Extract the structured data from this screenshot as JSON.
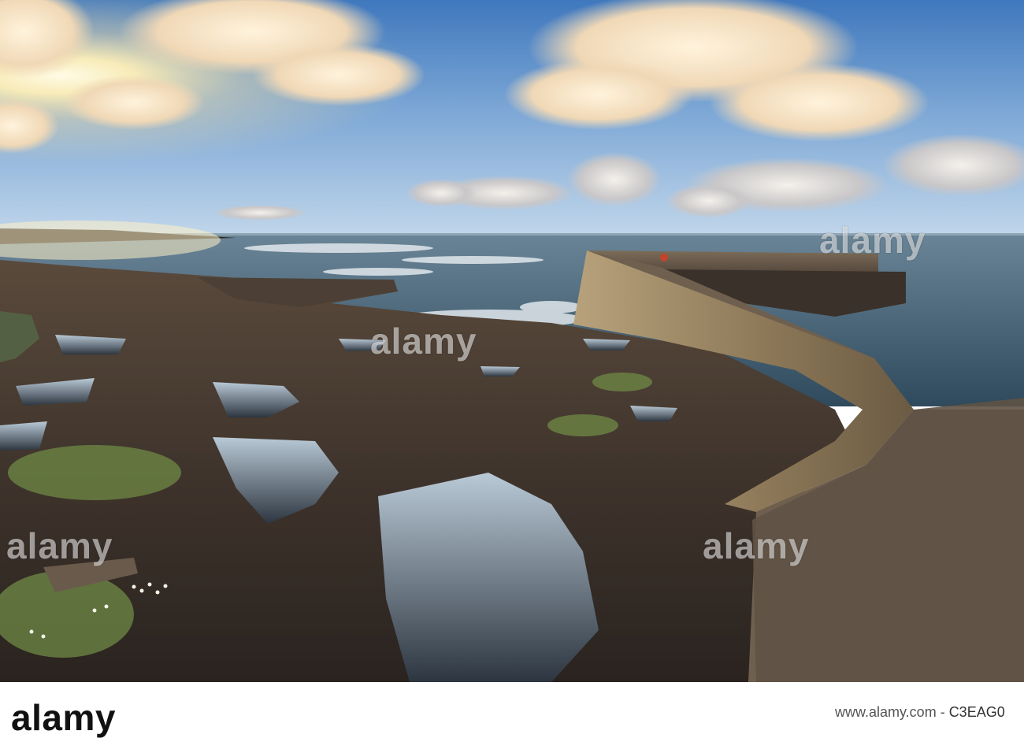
{
  "watermark": {
    "text": "alamy"
  },
  "footer": {
    "logo_text": "alamy",
    "image_id_prefix": "www.alamy.com - ",
    "image_id": "C3EAG0"
  },
  "colors": {
    "sky_top": "#4f86c6",
    "sky_mid": "#a9c7e3",
    "sun_glow": "#fff4c8",
    "sea": "#4e6878",
    "rocks": "#4a3c32",
    "pier": "#8a7a62"
  }
}
